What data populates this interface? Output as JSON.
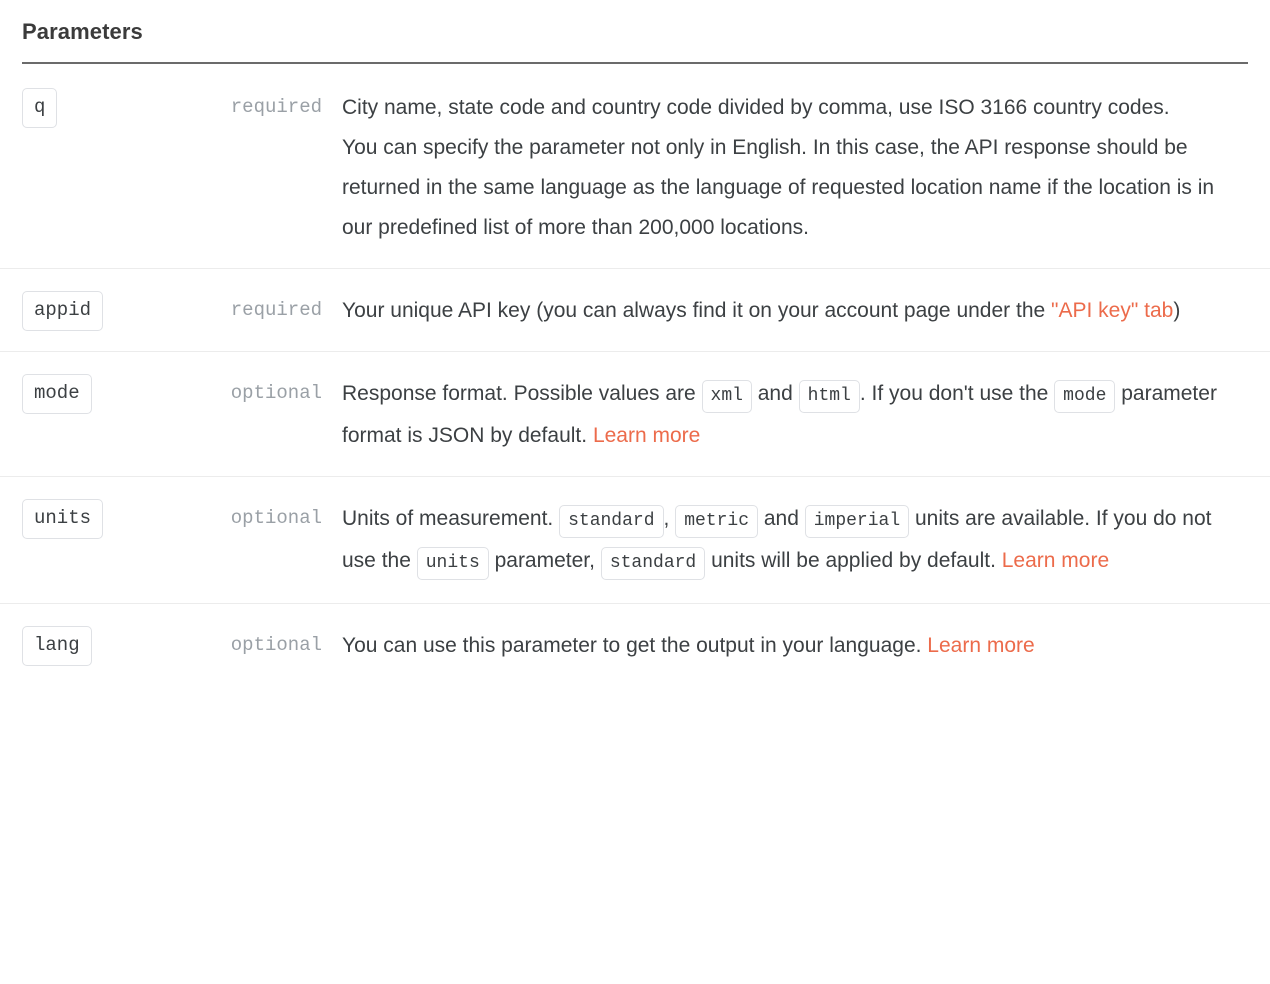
{
  "section": {
    "title": "Parameters",
    "accent_color": "#ec6b4b",
    "text_color": "#3c4043",
    "muted_color": "#9aa0a6",
    "rule_color": "#6b6b6b",
    "row_divider_color": "#ececec",
    "chip_border_color": "#dfe1e5"
  },
  "params": [
    {
      "name": "q",
      "requirement": "required",
      "parts": [
        {
          "type": "text",
          "value": "City name, state code and country code divided by comma, use ISO 3166 country codes."
        },
        {
          "type": "break"
        },
        {
          "type": "text",
          "value": "You can specify the parameter not only in English. In this case, the API response should be returned in the same language as the language of requested location name if the location is in our predefined list of more than 200,000 locations."
        }
      ]
    },
    {
      "name": "appid",
      "requirement": "required",
      "parts": [
        {
          "type": "text",
          "value": "Your unique API key (you can always find it on your account page under the "
        },
        {
          "type": "link",
          "value": "\"API key\" tab"
        },
        {
          "type": "text",
          "value": ")"
        }
      ]
    },
    {
      "name": "mode",
      "requirement": "optional",
      "parts": [
        {
          "type": "text",
          "value": "Response format. Possible values are "
        },
        {
          "type": "code",
          "value": "xml"
        },
        {
          "type": "text",
          "value": " and "
        },
        {
          "type": "code",
          "value": "html"
        },
        {
          "type": "text",
          "value": ". If you don't use the "
        },
        {
          "type": "code",
          "value": "mode"
        },
        {
          "type": "text",
          "value": " parameter format is JSON by default. "
        },
        {
          "type": "link",
          "value": "Learn more"
        }
      ]
    },
    {
      "name": "units",
      "requirement": "optional",
      "parts": [
        {
          "type": "text",
          "value": "Units of measurement. "
        },
        {
          "type": "code",
          "value": "standard"
        },
        {
          "type": "text",
          "value": ", "
        },
        {
          "type": "code",
          "value": "metric"
        },
        {
          "type": "text",
          "value": " and "
        },
        {
          "type": "code",
          "value": "imperial"
        },
        {
          "type": "text",
          "value": " units are available. If you do not use the "
        },
        {
          "type": "code",
          "value": "units"
        },
        {
          "type": "text",
          "value": " parameter, "
        },
        {
          "type": "code",
          "value": "standard"
        },
        {
          "type": "text",
          "value": " units will be applied by default. "
        },
        {
          "type": "link",
          "value": "Learn more"
        }
      ]
    },
    {
      "name": "lang",
      "requirement": "optional",
      "parts": [
        {
          "type": "text",
          "value": "You can use this parameter to get the output in your language. "
        },
        {
          "type": "link",
          "value": "Learn more"
        }
      ]
    }
  ]
}
